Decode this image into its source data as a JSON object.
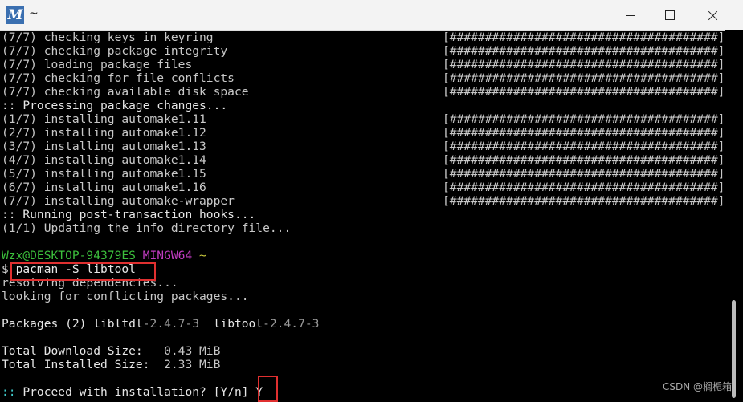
{
  "window": {
    "title": "~",
    "app_icon": "M"
  },
  "progress": [
    {
      "text": "(7/7) checking keys in keyring",
      "bar": "[######################################] 100%"
    },
    {
      "text": "(7/7) checking package integrity",
      "bar": "[######################################] 100%"
    },
    {
      "text": "(7/7) loading package files",
      "bar": "[######################################] 100%"
    },
    {
      "text": "(7/7) checking for file conflicts",
      "bar": "[######################################] 100%"
    },
    {
      "text": "(7/7) checking available disk space",
      "bar": "[######################################] 100%"
    }
  ],
  "processing": ":: Processing package changes...",
  "installs": [
    {
      "text": "(1/7) installing automake1.11",
      "bar": "[######################################] 100%"
    },
    {
      "text": "(2/7) installing automake1.12",
      "bar": "[######################################] 100%"
    },
    {
      "text": "(3/7) installing automake1.13",
      "bar": "[######################################] 100%"
    },
    {
      "text": "(4/7) installing automake1.14",
      "bar": "[######################################] 100%"
    },
    {
      "text": "(5/7) installing automake1.15",
      "bar": "[######################################] 100%"
    },
    {
      "text": "(6/7) installing automake1.16",
      "bar": "[######################################] 100%"
    },
    {
      "text": "(7/7) installing automake-wrapper",
      "bar": "[######################################] 100%"
    }
  ],
  "hooks": ":: Running post-transaction hooks...",
  "info": "(1/1) Updating the info directory file...",
  "prompt": {
    "user_host": "Wzx@DESKTOP-94379ES",
    "env": "MINGW64",
    "cwd": "~",
    "symbol": "$"
  },
  "command": "pacman -S libtool",
  "resolving": "resolving dependencies...",
  "looking": "looking for conflicting packages...",
  "packages": {
    "label": "Packages (2)",
    "pkg1_name": "libltdl",
    "pkg1_ver": "-2.4.7-3",
    "pkg2_name": "libtool",
    "pkg2_ver": "-2.4.7-3"
  },
  "download": {
    "label": "Total Download Size:",
    "value": "0.43 MiB"
  },
  "installed": {
    "label": "Total Installed Size:",
    "value": "2.33 MiB"
  },
  "proceed": {
    "prefix": "::",
    "text": " Proceed with installation? [Y/n] ",
    "answer": "Y"
  },
  "watermark": "CSDN @榈栀箱"
}
